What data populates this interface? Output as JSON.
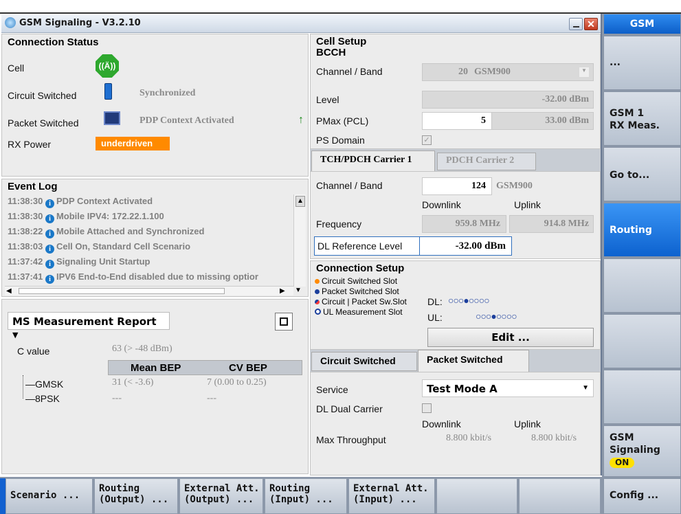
{
  "window": {
    "title": "GSM Signaling  - V3.2.10"
  },
  "connection_status": {
    "title": "Connection Status",
    "cell": "Cell",
    "circuit": "Circuit Switched",
    "circuit_val": "Synchronized",
    "packet": "Packet Switched",
    "packet_val": "PDP Context Activated",
    "rx": "RX Power",
    "rx_val": "underdriven",
    "rx_color": "#ff8a00"
  },
  "event_log": {
    "title": "Event Log",
    "entries": [
      {
        "time": "11:38:30",
        "text": "PDP Context Activated"
      },
      {
        "time": "11:38:30",
        "text": "Mobile IPV4: 172.22.1.100"
      },
      {
        "time": "11:38:22",
        "text": "Mobile Attached and Synchronized"
      },
      {
        "time": "11:38:03",
        "text": "Cell On, Standard Cell Scenario"
      },
      {
        "time": "11:37:42",
        "text": "Signaling Unit Startup"
      },
      {
        "time": "11:37:41",
        "text": "IPV6 End-to-End disabled due to missing optior"
      }
    ]
  },
  "ms_report": {
    "title": "MS Measurement Report",
    "c_label": "C value",
    "c_val": "63 (> -48 dBm)",
    "col1": "Mean BEP",
    "col2": "CV BEP",
    "gmsk": "GMSK",
    "gmsk_v1": "31 (< -3.6)",
    "gmsk_v2": "7 (0.00 to 0.25)",
    "psk": "8PSK",
    "psk_v1": "---",
    "psk_v2": "---"
  },
  "cell_setup": {
    "title": "Cell Setup",
    "subtitle": "BCCH",
    "chband_lbl": "Channel / Band",
    "chband_num": "20",
    "chband_band": "GSM900",
    "level_lbl": "Level",
    "level_val": "-32.00  dBm",
    "pmax_lbl": "PMax (PCL)",
    "pmax_val": "5",
    "pmax_dbm": "33.00  dBm",
    "ps_lbl": "PS Domain"
  },
  "carrier": {
    "tab1": "TCH/PDCH Carrier 1",
    "tab2": "PDCH Carrier 2",
    "chband_lbl": "Channel / Band",
    "ch_val": "124",
    "band": "GSM900",
    "downlink": "Downlink",
    "uplink": "Uplink",
    "freq_lbl": "Frequency",
    "freq_dl": "959.8  MHz",
    "freq_ul": "914.8  MHz",
    "dlref_lbl": "DL Reference Level",
    "dlref_val": "-32.00  dBm"
  },
  "conn_setup": {
    "title": "Connection Setup",
    "leg1": "Circuit Switched Slot",
    "leg2": "Packet Switched Slot",
    "leg3": "Circuit | Packet Sw.Slot",
    "leg4": "UL Measurement Slot",
    "dl": "DL:",
    "ul": "UL:",
    "dl_slots": "○○○●○○○○",
    "ul_slots": "○○○●○○○○",
    "edit": "Edit ..."
  },
  "service_tabs": {
    "tab1": "Circuit Switched",
    "tab2": "Packet Switched",
    "service_lbl": "Service",
    "service_val": "Test Mode A",
    "dual_lbl": "DL Dual Carrier",
    "downlink": "Downlink",
    "uplink": "Uplink",
    "tp_lbl": "Max Throughput",
    "tp_dl": "8.800  kbit/s",
    "tp_ul": "8.800  kbit/s"
  },
  "right_buttons": {
    "gsm": "GSM",
    "b1": "...",
    "b2a": "GSM 1",
    "b2b": "RX Meas.",
    "b3": "Go to...",
    "b4": "Routing",
    "b8a": "GSM",
    "b8b": "Signaling",
    "b8c": "ON",
    "config": "Config ..."
  },
  "bottom_buttons": {
    "b1": "Scenario ...",
    "b2": "Routing\n(Output) ...",
    "b3": "External Att.\n(Output) ...",
    "b4": "Routing\n(Input) ...",
    "b5": "External Att.\n(Input) ..."
  }
}
